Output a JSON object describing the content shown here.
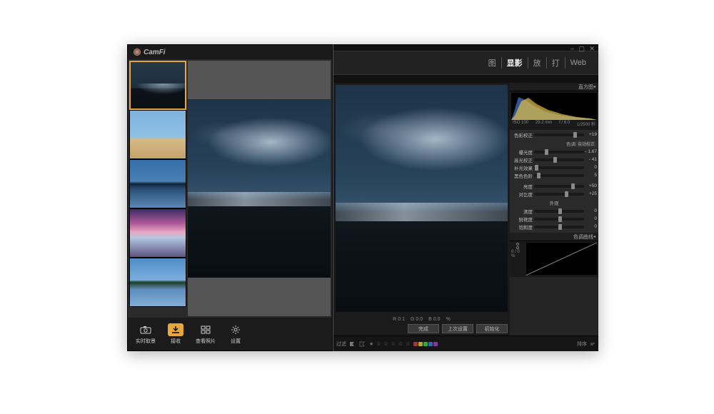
{
  "camfi": {
    "title": "CamFi",
    "footer": {
      "live": "实时取景",
      "receive": "接收",
      "browse": "查看照片",
      "settings": "设置"
    }
  },
  "editor": {
    "tabs": {
      "library": "图",
      "develop": "显影",
      "slideshow": "放",
      "print": "打",
      "web": "Web"
    },
    "histogram": {
      "title": "直方图",
      "iso": "ISO 100",
      "focal": "29.2 mm",
      "aperture": "f / 8.0",
      "shutter": "1/2500 秒"
    },
    "panels": {
      "basic_top_label": "色彩校正",
      "tone_label": "色调",
      "auto": "自动校正",
      "presence_label": "外观",
      "curve": "色调曲线"
    },
    "sliders": {
      "wb": {
        "label": "色彩校正",
        "value": "+19"
      },
      "exposure": {
        "label": "曝光度",
        "value": "- 1.67"
      },
      "highlights": {
        "label": "高光校正",
        "value": "- 41"
      },
      "fill": {
        "label": "补光效果",
        "value": "0"
      },
      "blacks": {
        "label": "黑色色阶",
        "value": "5"
      },
      "brightness": {
        "label": "亮度",
        "value": "+50"
      },
      "contrast": {
        "label": "对比度",
        "value": "+25"
      },
      "clarity": {
        "label": "清度",
        "value": "0"
      },
      "vibrance": {
        "label": "鲜艳度",
        "value": "0"
      },
      "saturation": {
        "label": "饱和度",
        "value": "0"
      }
    },
    "curve_pct": "0 / 0 %",
    "status": {
      "r": "R  0.1",
      "g": "G  0.0",
      "b": "B  0.0",
      "pct": "%"
    },
    "buttons": {
      "done": "完成",
      "previous": "上次设置",
      "reset": "初始化"
    },
    "filmstrip": {
      "filter": "过滤",
      "sort": "排序"
    }
  },
  "chart_data": {
    "type": "area",
    "title": "直方图",
    "xlabel": "",
    "ylabel": "",
    "xlim": [
      0,
      255
    ],
    "ylim": [
      0,
      100
    ],
    "series": [
      {
        "name": "blue",
        "color": "#3b63b3",
        "x": [
          0,
          10,
          22,
          40,
          60,
          90,
          130,
          180,
          230,
          255
        ],
        "values": [
          10,
          55,
          95,
          78,
          48,
          30,
          18,
          10,
          4,
          0
        ]
      },
      {
        "name": "yellow",
        "color": "#e2c044",
        "x": [
          0,
          12,
          28,
          48,
          70,
          100,
          140,
          190,
          235,
          255
        ],
        "values": [
          6,
          38,
          82,
          90,
          60,
          36,
          22,
          12,
          5,
          0
        ]
      }
    ]
  }
}
